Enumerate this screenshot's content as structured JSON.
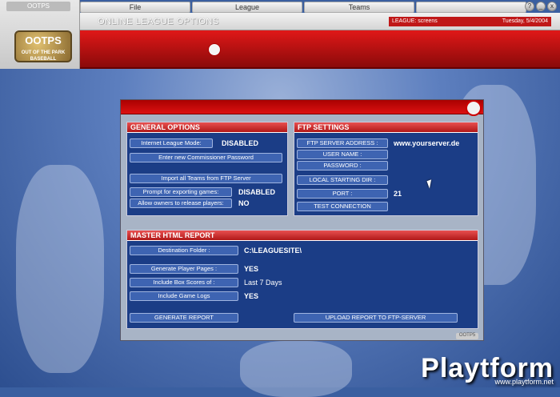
{
  "menu": {
    "items": [
      "File",
      "League",
      "Teams"
    ]
  },
  "window": {
    "buttons": [
      "?",
      "_",
      "x"
    ]
  },
  "logo": {
    "tab_label": "OOTPS",
    "title": "OOTPS",
    "subtitle": "OUT OF THE PARK BASEBALL"
  },
  "header": {
    "title": "ONLINE LEAGUE OPTIONS",
    "league_label": "LEAGUE: screens",
    "date": "Tuesday, 5/4/2004"
  },
  "general": {
    "title": "GENERAL OPTIONS",
    "internet_mode_label": "Internet League Mode:",
    "internet_mode_value": "DISABLED",
    "commissioner_btn": "Enter new Commissioner Password",
    "import_btn": "Import all Teams from FTP Server",
    "prompt_label": "Prompt for exporting games:",
    "prompt_value": "DISABLED",
    "allow_label": "Allow owners to release players:",
    "allow_value": "NO"
  },
  "ftp": {
    "title": "FTP SETTINGS",
    "server_label": "FTP SERVER ADDRESS :",
    "server_value": "www.yourserver.de",
    "user_label": "USER NAME :",
    "password_label": "PASSWORD :",
    "local_dir_label": "LOCAL STARTING DIR :",
    "port_label": "PORT :",
    "port_value": "21",
    "test_btn": "TEST CONNECTION"
  },
  "html_report": {
    "title": "MASTER HTML REPORT",
    "dest_label": "Destination Folder :",
    "dest_value": "C:\\LEAGUESITE\\",
    "player_pages_label": "Generate Player Pages :",
    "player_pages_value": "YES",
    "box_scores_label": "Include Box Scores of :",
    "box_scores_value": "Last 7 Days",
    "game_logs_label": "Include Game Logs",
    "game_logs_value": "YES",
    "generate_btn": "GENERATE REPORT",
    "upload_btn": "UPLOAD REPORT TO FTP-SERVER"
  },
  "panel_footer": "OOTP5",
  "watermark": {
    "brand": "Playtform",
    "url": "www.playtform.net"
  }
}
